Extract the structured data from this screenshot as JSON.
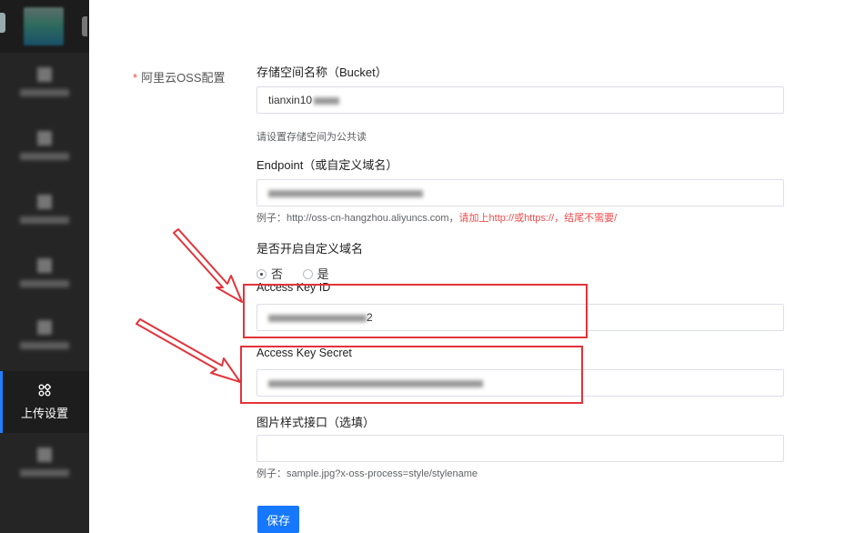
{
  "sidebar": {
    "active_item": {
      "label": "上传设置",
      "icon": "grid-icon"
    }
  },
  "form": {
    "section_label": "阿里云OSS配置",
    "required_mark": "*",
    "bucket": {
      "label": "存储空间名称（Bucket）",
      "value": "tianxin10",
      "hint": "请设置存储空间为公共读"
    },
    "endpoint": {
      "label": "Endpoint（或自定义域名）",
      "hint_example": "例子：http://oss-cn-hangzhou.aliyuncs.com，",
      "hint_warning": "请加上http://或https://，结尾不需要/"
    },
    "custom_domain": {
      "label": "是否开启自定义域名",
      "options": [
        "否",
        "是"
      ],
      "selected": "否"
    },
    "access_key_id": {
      "label": "Access Key ID",
      "value_suffix": "2"
    },
    "access_key_secret": {
      "label": "Access Key Secret"
    },
    "image_style": {
      "label": "图片样式接口（选填）",
      "hint": "例子：sample.jpg?x-oss-process=style/stylename"
    },
    "save_label": "保存"
  },
  "colors": {
    "sidebar_bg": "#252525",
    "accent": "#1677ff",
    "annotation": "#e3333a"
  }
}
